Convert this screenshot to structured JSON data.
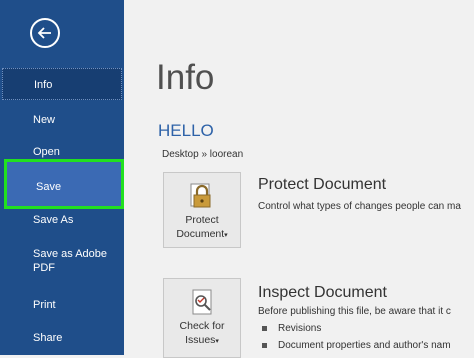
{
  "sidebar": {
    "items": [
      {
        "label": "Info"
      },
      {
        "label": "New"
      },
      {
        "label": "Open"
      },
      {
        "label": "Save"
      },
      {
        "label": "Save As"
      },
      {
        "label": "Save as Adobe PDF"
      },
      {
        "label": "Print"
      },
      {
        "label": "Share"
      }
    ],
    "bg_color": "#1f4e8a",
    "highlight_color": "#21e01f"
  },
  "main": {
    "title": "Info",
    "doc_name": "HELLO",
    "breadcrumb": "Desktop » loorean",
    "protect": {
      "button_line1": "Protect",
      "button_line2": "Document",
      "title": "Protect Document",
      "description": "Control what types of changes people can ma"
    },
    "inspect": {
      "button_line1": "Check for",
      "button_line2": "Issues",
      "title": "Inspect Document",
      "description": "Before publishing this file, be aware that it c",
      "bullets": [
        "Revisions",
        "Document properties and author's nam"
      ]
    }
  }
}
